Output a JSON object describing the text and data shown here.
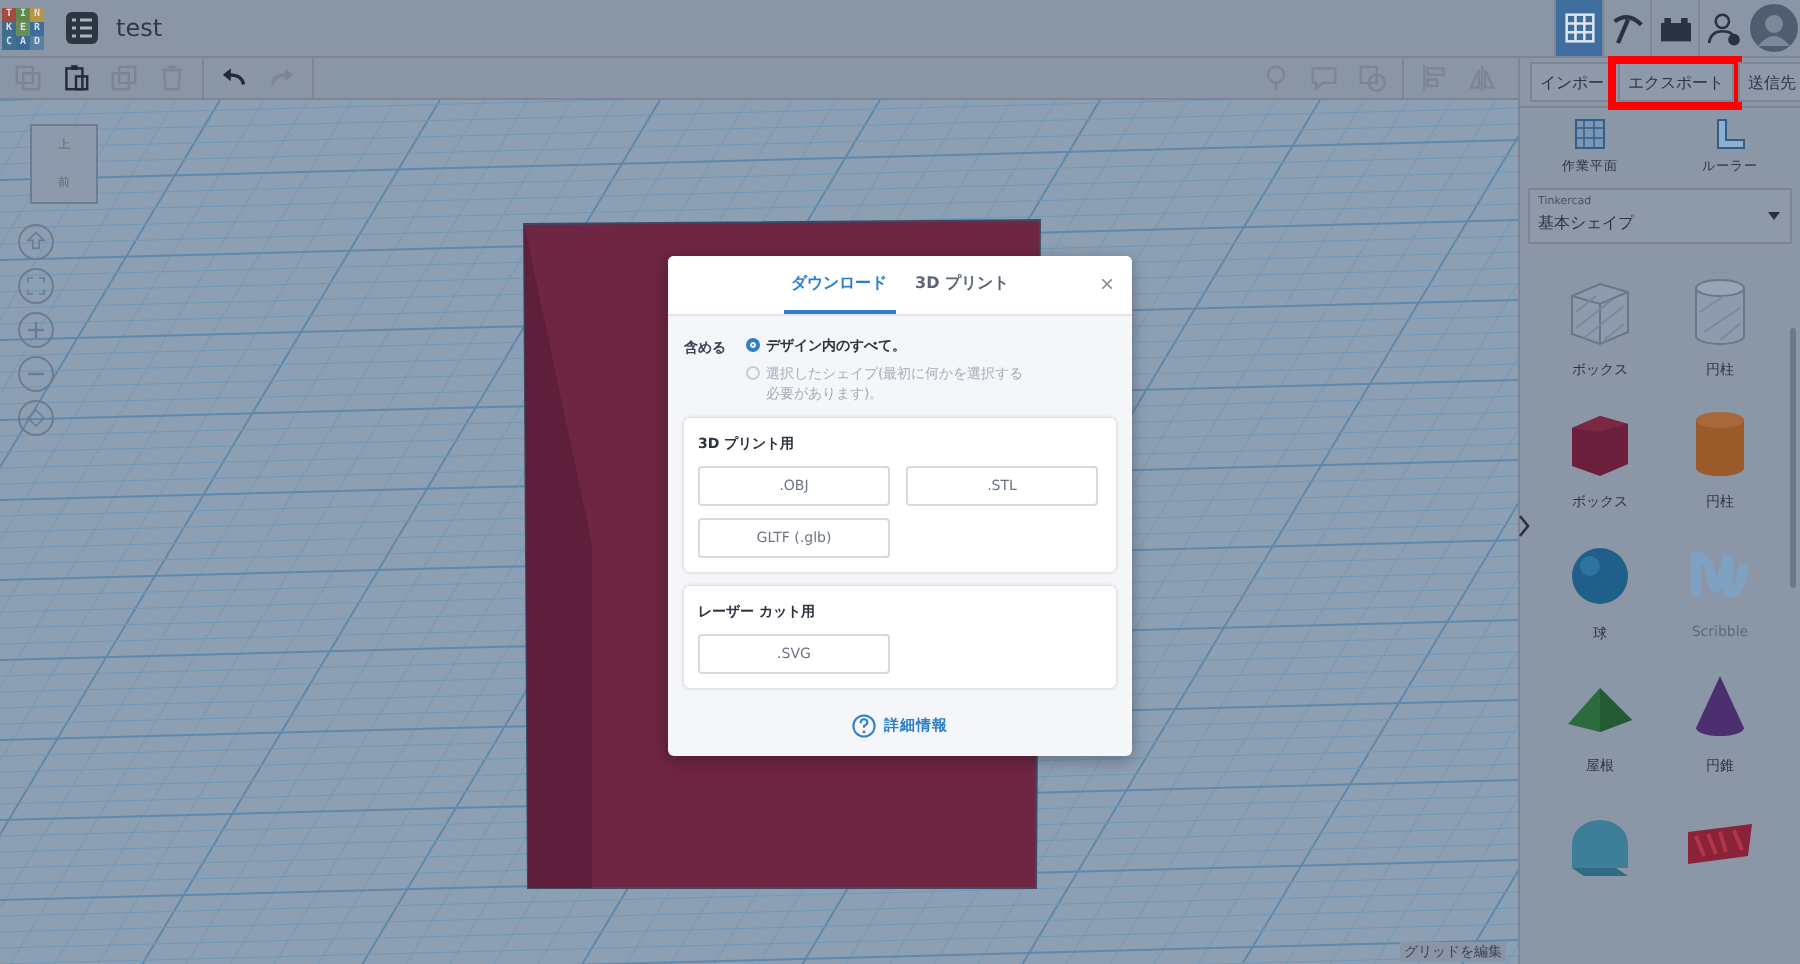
{
  "app": {
    "logo_rows": [
      "TIN",
      "KER",
      "CAD"
    ],
    "document_title": "test"
  },
  "top_nav": [
    {
      "kind": "grid",
      "selected": true
    },
    {
      "kind": "pickaxe",
      "selected": false
    },
    {
      "kind": "bricks",
      "selected": false
    },
    {
      "kind": "user_add",
      "selected": false
    }
  ],
  "edit_tools": [
    {
      "kind": "copy",
      "disabled": true
    },
    {
      "kind": "paste",
      "disabled": false
    },
    {
      "kind": "duplicate",
      "disabled": true
    },
    {
      "kind": "delete",
      "disabled": true
    },
    {
      "kind": "undo",
      "disabled": false
    },
    {
      "kind": "redo",
      "disabled": true
    }
  ],
  "shape_tools": [
    {
      "kind": "note",
      "disabled": true
    },
    {
      "kind": "comment",
      "disabled": true
    },
    {
      "kind": "group",
      "disabled": true
    },
    {
      "kind": "align",
      "disabled": true
    },
    {
      "kind": "mirror",
      "disabled": true
    }
  ],
  "action_buttons": [
    {
      "label": "インポー",
      "highlighted": false
    },
    {
      "label": "エクスポート",
      "highlighted": true
    },
    {
      "label": "送信先",
      "highlighted": false
    }
  ],
  "panel_tools": [
    {
      "kind": "workplane",
      "label": "作業平面"
    },
    {
      "kind": "ruler",
      "label": "ルーラー"
    }
  ],
  "shape_library": {
    "source": "Tinkercad",
    "category": "基本シェイプ"
  },
  "shapes": [
    {
      "kind": "box_hole",
      "label": "ボックス"
    },
    {
      "kind": "cylinder_hole",
      "label": "円柱"
    },
    {
      "kind": "box",
      "label": "ボックス"
    },
    {
      "kind": "cylinder",
      "label": "円柱"
    },
    {
      "kind": "sphere",
      "label": "球"
    },
    {
      "kind": "scribble",
      "label": "Scribble"
    },
    {
      "kind": "roof",
      "label": "屋根"
    },
    {
      "kind": "cone",
      "label": "円錐"
    },
    {
      "kind": "half_cylinder"
    },
    {
      "kind": "text"
    }
  ],
  "view_cube": {
    "top": "上",
    "front": "前"
  },
  "view_controls": [
    {
      "kind": "home"
    },
    {
      "kind": "fit"
    },
    {
      "kind": "zoom_in"
    },
    {
      "kind": "zoom_out"
    },
    {
      "kind": "perspective"
    }
  ],
  "grid_edit": "グリッドを編集",
  "dialog": {
    "tabs": [
      {
        "label": "ダウンロード",
        "selected": true
      },
      {
        "label": "3D プリント",
        "selected": false
      }
    ],
    "close": "×",
    "include_label": "含める",
    "options": [
      {
        "label": "デザイン内のすべて。",
        "selected": true,
        "disabled": false
      },
      {
        "label": "選択したシェイプ(最初に何かを選択する必要があります)。",
        "selected": false,
        "disabled": true
      }
    ],
    "sections": [
      {
        "title": "3D プリント用",
        "formats": [
          ".OBJ",
          ".STL",
          "GLTF (.glb)"
        ]
      },
      {
        "title": "レーザー カット用",
        "formats": [
          ".SVG"
        ]
      }
    ],
    "help_link": "詳細情報"
  }
}
